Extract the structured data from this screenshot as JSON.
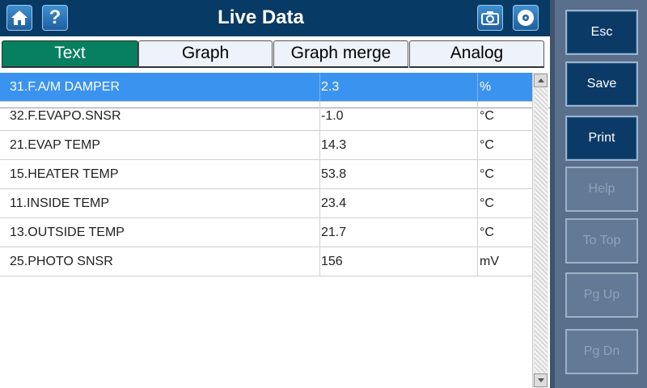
{
  "header": {
    "title": "Live Data",
    "left_icons": [
      "home-icon",
      "help-icon"
    ],
    "right_icons": [
      "camera-icon",
      "disc-icon"
    ],
    "help_glyph": "?"
  },
  "tabs": [
    {
      "label": "Text",
      "active": true
    },
    {
      "label": "Graph",
      "active": false
    },
    {
      "label": "Graph merge",
      "active": false
    },
    {
      "label": "Analog",
      "active": false
    }
  ],
  "rows": [
    {
      "name": "31.F.A/M DAMPER",
      "value": "2.3",
      "unit": "%",
      "selected": true
    },
    {
      "name": "32.F.EVAPO.SNSR",
      "value": "-1.0",
      "unit": "°C",
      "selected": false
    },
    {
      "name": "21.EVAP TEMP",
      "value": "14.3",
      "unit": "°C",
      "selected": false
    },
    {
      "name": "15.HEATER TEMP",
      "value": "53.8",
      "unit": "°C",
      "selected": false
    },
    {
      "name": "11.INSIDE TEMP",
      "value": "23.4",
      "unit": "°C",
      "selected": false
    },
    {
      "name": "13.OUTSIDE TEMP",
      "value": "21.7",
      "unit": "°C",
      "selected": false
    },
    {
      "name": "25.PHOTO SNSR",
      "value": "156",
      "unit": "mV",
      "selected": false
    }
  ],
  "side_buttons": {
    "esc": {
      "label": "Esc",
      "enabled": true
    },
    "save": {
      "label": "Save",
      "enabled": true
    },
    "print": {
      "label": "Print",
      "enabled": true
    },
    "help": {
      "label": "Help",
      "enabled": false
    },
    "to_top": {
      "label": "To Top",
      "enabled": false
    },
    "pg_up": {
      "label": "Pg Up",
      "enabled": false
    },
    "pg_dn": {
      "label": "Pg Dn",
      "enabled": false
    }
  },
  "colors": {
    "header_bg": "#083a66",
    "active_tab": "#078060",
    "selected_row": "#3b93f0",
    "side_panel": "#5a6f8c",
    "enabled_button": "#0b3a66",
    "disabled_button": "#627a96"
  }
}
